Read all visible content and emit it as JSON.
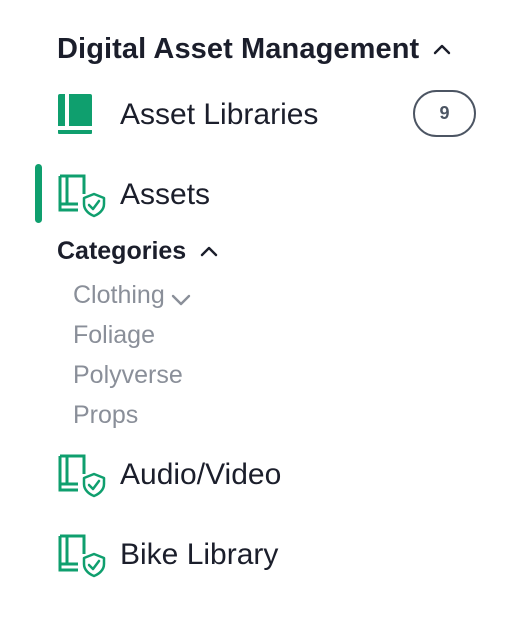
{
  "section": {
    "title": "Digital Asset Management",
    "chevron_icon": "chevron-up-icon"
  },
  "items": {
    "asset_libraries": {
      "label": "Asset Libraries",
      "badge": "9",
      "icon": "book-icon"
    },
    "assets": {
      "label": "Assets",
      "icon": "book-shield-icon",
      "active": true
    },
    "audio_video": {
      "label": "Audio/Video",
      "icon": "book-shield-icon"
    },
    "bike_library": {
      "label": "Bike Library",
      "icon": "book-shield-icon"
    }
  },
  "categories": {
    "title": "Categories",
    "chevron_icon": "chevron-up-icon",
    "items": [
      "Clothing",
      "Foliage",
      "Polyverse",
      "Props"
    ],
    "expandable_item_icon": "chevron-down-icon"
  },
  "colors": {
    "accent": "#0f9f6e",
    "text": "#1b1e2b",
    "muted": "#8a8f99",
    "badge_border": "#4c5563"
  }
}
